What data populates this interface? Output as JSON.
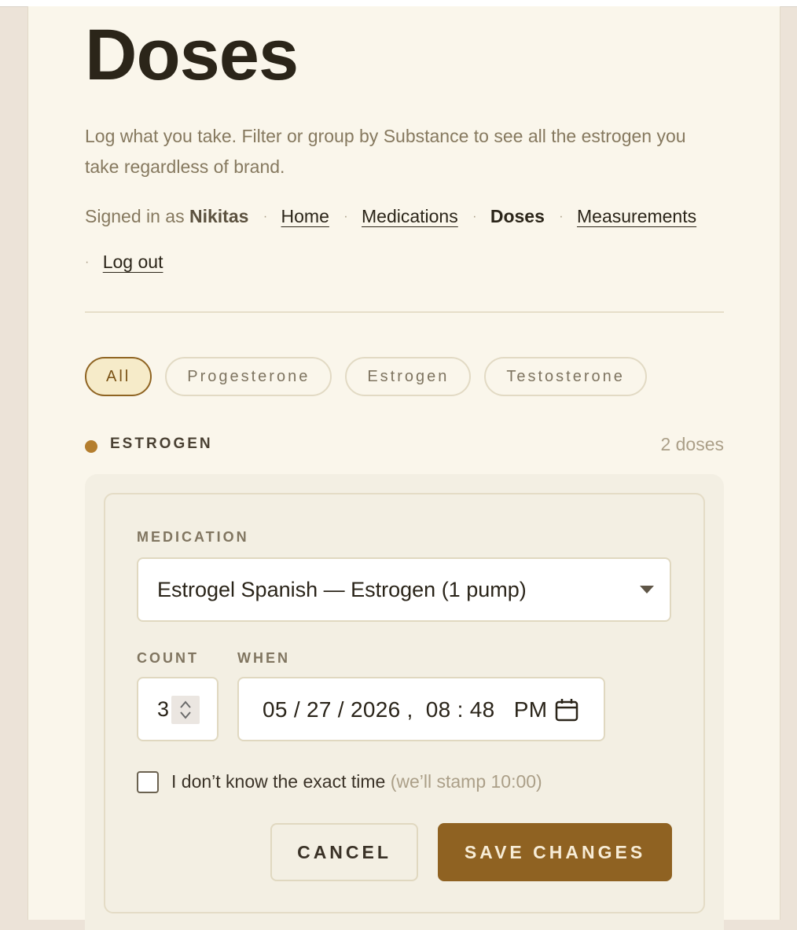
{
  "page": {
    "title": "Doses",
    "intro": "Log what you take. Filter or group by Substance to see all the estrogen you take regardless of brand."
  },
  "nav": {
    "signed_in_prefix": "Signed in as",
    "username": "Nikitas",
    "separator": "·",
    "links": {
      "home": "Home",
      "medications": "Medications",
      "doses": "Doses",
      "measurements": "Measurements",
      "logout": "Log out"
    },
    "current": "Doses"
  },
  "filters": {
    "items": [
      "All",
      "Progesterone",
      "Estrogen",
      "Testosterone"
    ],
    "active": "All"
  },
  "group": {
    "name": "ESTROGEN",
    "count_label": "2 doses",
    "dot_color": "#b47e2e"
  },
  "form": {
    "medication_label": "MEDICATION",
    "medication_value": "Estrogel Spanish — Estrogen (1 pump)",
    "count_label": "COUNT",
    "count_value": "3",
    "when_label": "WHEN",
    "when_value": "05 / 27 / 2026 ,  08 : 48   PM",
    "unknown_time_label": "I don’t know the exact time",
    "unknown_time_hint": "(we’ll stamp 10:00)",
    "unknown_time_checked": false,
    "cancel_label": "CANCEL",
    "save_label": "SAVE CHANGES"
  },
  "colors": {
    "accent": "#8f6222",
    "background": "#faf6eb",
    "active_pill_bg": "#f6ebc9"
  },
  "icons": {
    "dropdown": "chevron-down-icon",
    "spinner": "spinner-arrows-icon",
    "calendar": "calendar-icon"
  }
}
